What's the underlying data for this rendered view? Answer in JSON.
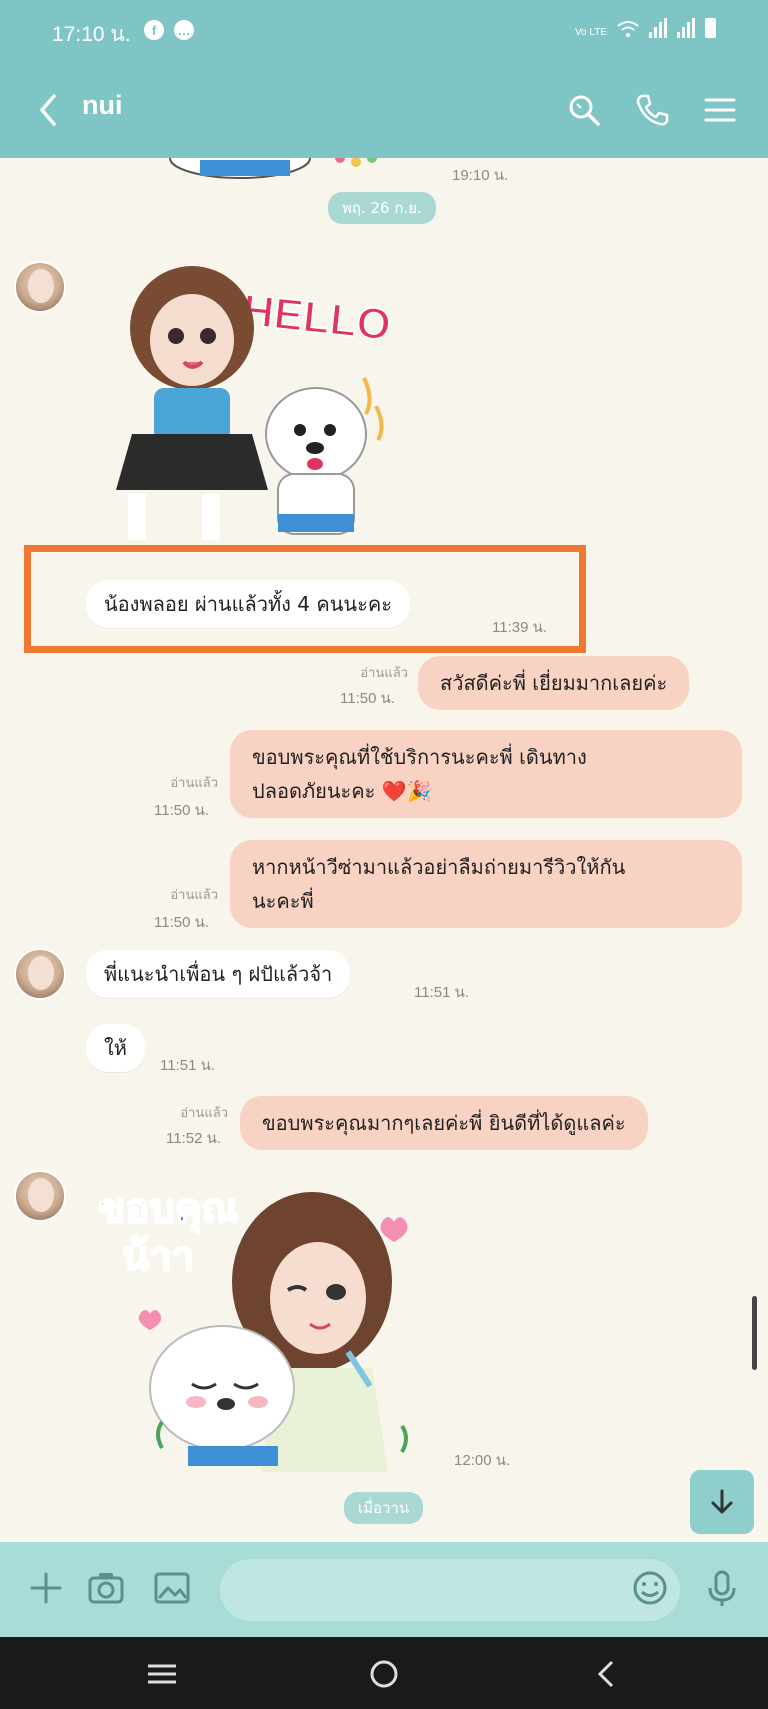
{
  "status_bar": {
    "time": "17:10 น.",
    "left_icons": [
      "facebook-icon",
      "line-icon"
    ],
    "right_icons": [
      "volte-icon",
      "wifi-icon",
      "signal-icon",
      "signal-icon",
      "battery-icon"
    ],
    "volte_text": "Vo LTE"
  },
  "header": {
    "title": "nui",
    "icons": [
      "back-icon",
      "search-icon",
      "phone-icon",
      "menu-icon"
    ]
  },
  "chat": {
    "top_time": "19:10 น.",
    "date_pill": "พฤ. 26 ก.ย.",
    "hello_sticker_text": "HELLO",
    "incoming_1": {
      "text": "น้องพลอย ผ่านแล้วทั้ง 4 คนนะคะ",
      "time": "11:39 น."
    },
    "outgoing_1": {
      "text": "สวัสดีค่ะพี่ เยี่ยมมากเลยค่ะ",
      "read": "อ่านแล้ว",
      "time": "11:50 น."
    },
    "outgoing_2": {
      "line1": "ขอบพระคุณที่ใช้บริการนะคะพี่ เดินทาง",
      "line2": "ปลอดภัยนะคะ ❤️🎉",
      "read": "อ่านแล้ว",
      "time": "11:50 น."
    },
    "outgoing_3": {
      "line1": "หากหน้าวีซ่ามาแล้วอย่าลืมถ่ายมารีวิวให้กัน",
      "line2": "นะคะพี่",
      "read": "อ่านแล้ว",
      "time": "11:50 น."
    },
    "incoming_2": {
      "text": "พี่แนะนำเพื่อน ๆ ฝปัแล้วจ้า",
      "time": "11:51 น."
    },
    "incoming_3": {
      "text": "ให้",
      "time": "11:51 น."
    },
    "outgoing_4": {
      "text": "ขอบพระคุณมากๆเลยค่ะพี่ ยินดีที่ได้ดูแลค่ะ",
      "read": "อ่านแล้ว",
      "time": "11:52 น."
    },
    "thanks_sticker_text_1": "ขอบคุณ",
    "thanks_sticker_text_2": "น้าา",
    "sticker_time": "12:00 น.",
    "bottom_pill": "เมื่อวาน"
  },
  "input_bar": {
    "placeholder": "",
    "icons": [
      "plus-icon",
      "camera-icon",
      "image-icon",
      "emoji-icon",
      "mic-icon"
    ]
  },
  "colors": {
    "header": "#7fc5c6",
    "incoming_bubble": "#ffffff",
    "outgoing_bubble": "#f8d2c2",
    "highlight": "#f07833",
    "background": "#f7f5ec"
  }
}
